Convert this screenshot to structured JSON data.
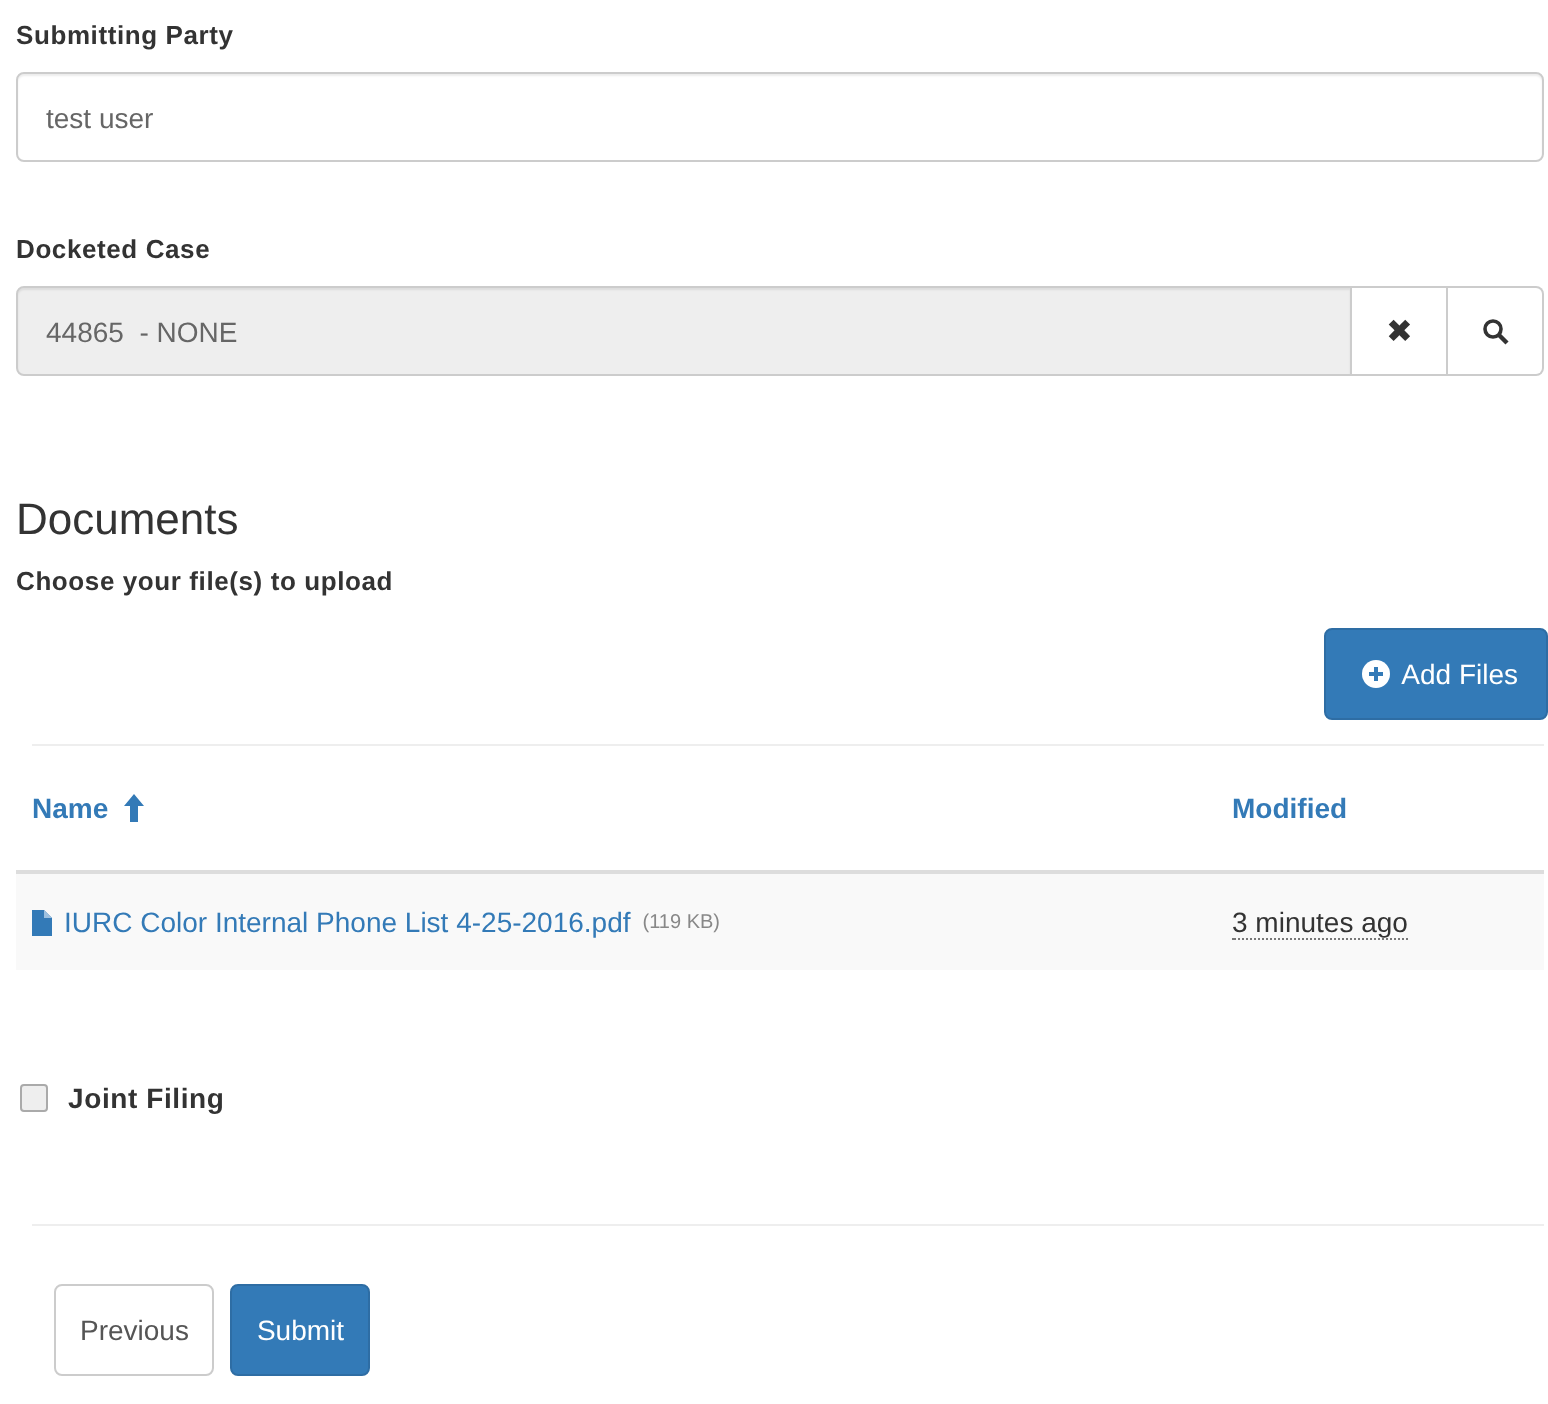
{
  "submitting_party": {
    "label": "Submitting Party",
    "value": "test user"
  },
  "docketed_case": {
    "label": "Docketed Case",
    "value": "44865  - NONE",
    "clear_button": "✖"
  },
  "documents": {
    "heading": "Documents",
    "instruction": "Choose your file(s) to upload",
    "add_button": "Add Files",
    "table": {
      "columns": [
        {
          "label": "Name",
          "sorted": true
        },
        {
          "label": "Modified",
          "sorted": false
        }
      ],
      "rows": [
        {
          "name": "IURC Color Internal Phone List 4-25-2016.pdf",
          "size": "(119 KB)",
          "modified": "3 minutes ago"
        }
      ]
    }
  },
  "joint_filing": {
    "label": "Joint Filing",
    "checked": false
  },
  "buttons": [
    {
      "label": "Previous",
      "kind": "default"
    },
    {
      "label": "Submit",
      "kind": "primary"
    }
  ]
}
